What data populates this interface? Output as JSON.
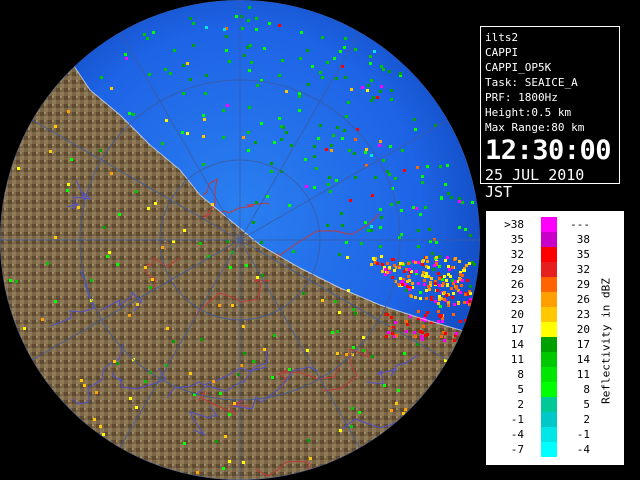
{
  "info": {
    "lines": [
      "ilts2",
      "CAPPI",
      "CAPPI_OP5K",
      "Task: SEAICE_A",
      "PRF: 1800Hz",
      "Height:0.5 km",
      "Max Range:80 km"
    ],
    "time": "12:30:00",
    "date": "25 JUL 2010 JST"
  },
  "legend": {
    "unit_label": "Reflectivity in dBZ",
    "rows": [
      {
        "lo": ">38",
        "hi": "---",
        "color": "#ff00ff"
      },
      {
        "lo": "35",
        "hi": "38",
        "color": "#c800c8"
      },
      {
        "lo": "32",
        "hi": "35",
        "color": "#ff0000"
      },
      {
        "lo": "29",
        "hi": "32",
        "color": "#e61e1e"
      },
      {
        "lo": "26",
        "hi": "29",
        "color": "#ff6400"
      },
      {
        "lo": "23",
        "hi": "26",
        "color": "#ffa000"
      },
      {
        "lo": "20",
        "hi": "23",
        "color": "#ffc800"
      },
      {
        "lo": "17",
        "hi": "20",
        "color": "#ffff00"
      },
      {
        "lo": "14",
        "hi": "17",
        "color": "#00a000"
      },
      {
        "lo": "11",
        "hi": "14",
        "color": "#00c800"
      },
      {
        "lo": "8",
        "hi": "11",
        "color": "#00e600"
      },
      {
        "lo": "5",
        "hi": "8",
        "color": "#00ff00"
      },
      {
        "lo": "2",
        "hi": "5",
        "color": "#00c896"
      },
      {
        "lo": "-1",
        "hi": "2",
        "color": "#00c8c8"
      },
      {
        "lo": "-4",
        "hi": "-1",
        "color": "#00e6e6"
      },
      {
        "lo": "-7",
        "hi": "-4",
        "color": "#00ffff"
      }
    ]
  },
  "map": {
    "sea_color": "#1e64e6",
    "land_color": "#6e5a3c",
    "range_rings": 3,
    "echo_palette": [
      "#00ff00",
      "#00c800",
      "#00a000",
      "#ffff00",
      "#ffc800",
      "#ffa000",
      "#ff6400",
      "#ff0000",
      "#ff00ff",
      "#00e6e6"
    ]
  }
}
